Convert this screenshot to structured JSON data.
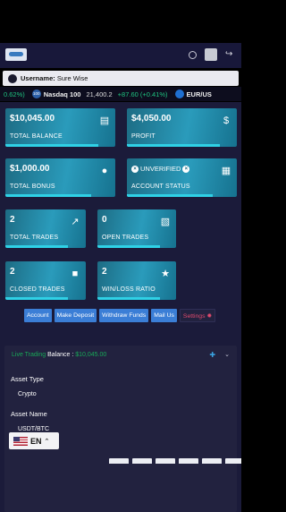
{
  "header": {
    "logo_label": "logo",
    "username_label": "Username:",
    "username_value": "Sure Wise"
  },
  "ticker": {
    "first_change": "0.62%)",
    "index_badge": "100",
    "index_name": "Nasdaq 100",
    "index_value": "21,400.2",
    "index_change": "+87.60 (+0.41%)",
    "pair_name": "EUR/US"
  },
  "cards": {
    "total_balance": {
      "value": "$10,045.00",
      "label": "TOTAL BALANCE"
    },
    "profit": {
      "value": "$4,050.00",
      "label": "PROFIT"
    },
    "total_bonus": {
      "value": "$1,000.00",
      "label": "TOTAL BONUS"
    },
    "account_status": {
      "value": "UNVERIFIED",
      "label": "ACCOUNT STATUS"
    },
    "total_trades": {
      "value": "2",
      "label": "TOTAL TRADES"
    },
    "open_trades": {
      "value": "0",
      "label": "OPEN TRADES"
    },
    "closed_trades": {
      "value": "2",
      "label": "CLOSED TRADES"
    },
    "win_loss_ratio": {
      "value": "2",
      "label": "WIN/LOSS RATIO"
    }
  },
  "tabs": {
    "account": "Account",
    "make_deposit": "Make Deposit",
    "withdraw_funds": "Withdraw Funds",
    "mail_us": "Mail Us",
    "settings": "Settings"
  },
  "trade_panel": {
    "title": "Live Trading",
    "balance_label": "Balance :",
    "balance_value": "$10,045.00",
    "asset_type_label": "Asset Type",
    "asset_type_value": "Crypto",
    "asset_name_label": "Asset Name",
    "asset_name_value": "USDT/BTC"
  },
  "language": {
    "code": "EN"
  },
  "icons": {
    "globe": "globe-icon",
    "avatar": "avatar",
    "logout": "logout-icon",
    "user": "user-icon",
    "balance": "chart-bar-icon",
    "profit": "dollar-icon",
    "bonus": "users-icon",
    "status": "id-card-icon",
    "trades": "line-chart-icon",
    "open": "folder-open-icon",
    "closed": "folder-icon",
    "trophy": "trophy-icon",
    "settings": "gear-icon"
  },
  "colors": {
    "background": "#1b1b3a",
    "card": "#2a9bbb",
    "accent_bar": "#2fd1e6",
    "tab": "#3b7ed6",
    "positive": "#1fc27f",
    "settings": "#e04a6d"
  }
}
